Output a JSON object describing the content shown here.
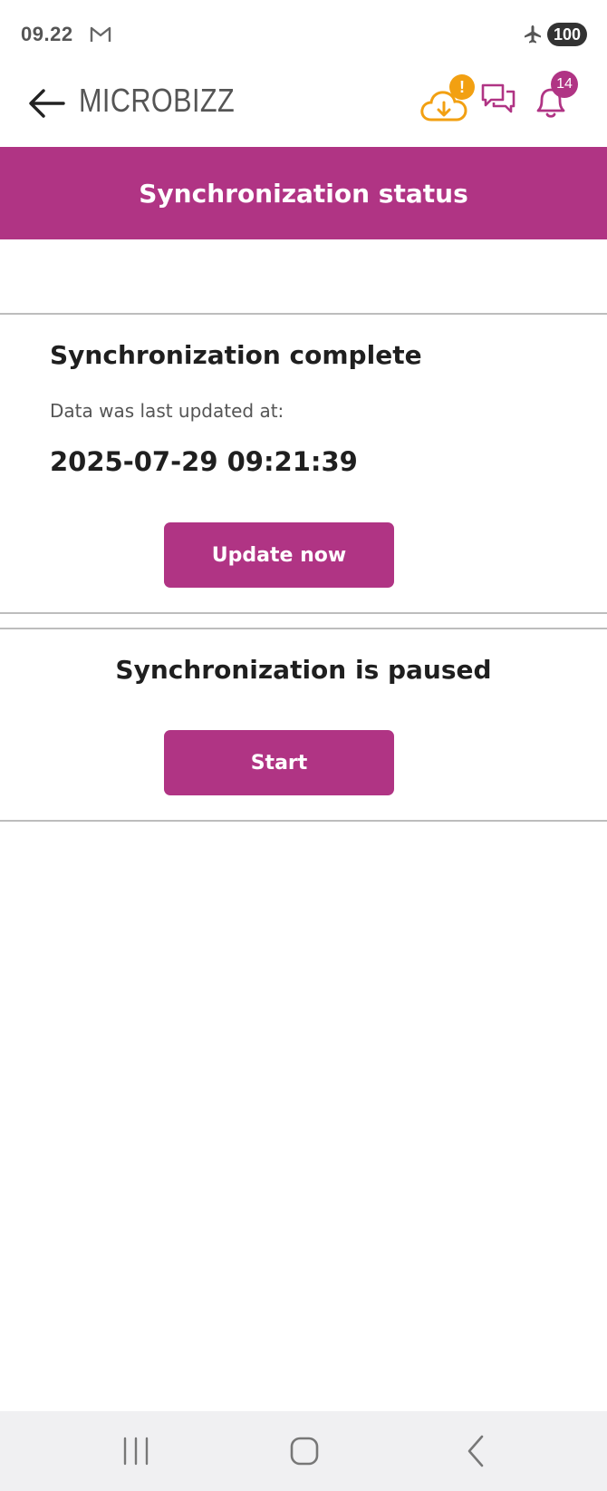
{
  "status_bar": {
    "time": "09.22",
    "battery": "100",
    "icons": [
      "gmail-icon",
      "airplane-icon"
    ]
  },
  "app_bar": {
    "title": "MICROBIZZ",
    "back_icon": "arrow-left-icon",
    "cloud_warning": "!",
    "notification_count": "14",
    "colors": {
      "accent": "#b03484",
      "warning": "#f2a012",
      "text": "#555555"
    }
  },
  "header": {
    "title": "Synchronization status"
  },
  "sync_card": {
    "title": "Synchronization complete",
    "label": "Data was last updated at:",
    "timestamp": "2025-07-29 09:21:39",
    "button_label": "Update now"
  },
  "pause_card": {
    "title": "Synchronization is paused",
    "button_label": "Start"
  },
  "nav_bar": {
    "icons": [
      "recents-icon",
      "home-icon",
      "back-nav-icon"
    ]
  }
}
